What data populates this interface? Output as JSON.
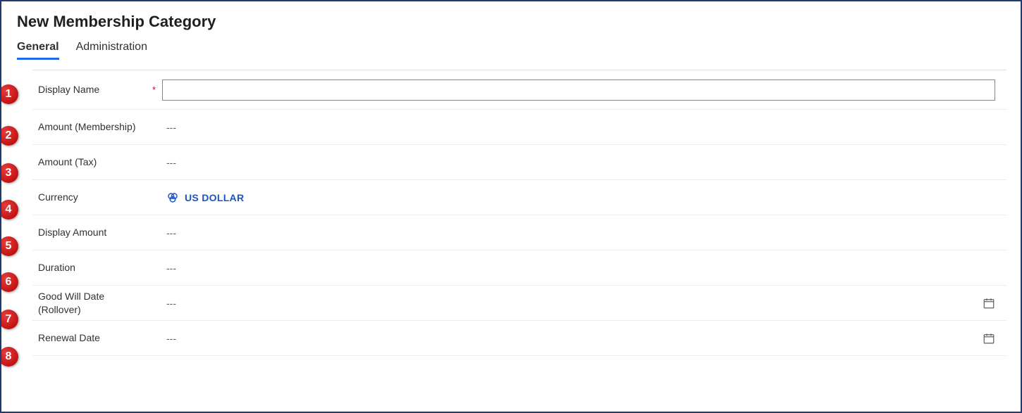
{
  "page_title": "New Membership Category",
  "tabs": [
    {
      "label": "General",
      "active": true
    },
    {
      "label": "Administration",
      "active": false
    }
  ],
  "rows": [
    {
      "num": "1",
      "label": "Display Name",
      "required": true,
      "kind": "input",
      "value": ""
    },
    {
      "num": "2",
      "label": "Amount (Membership)",
      "required": false,
      "kind": "text",
      "value": "---"
    },
    {
      "num": "3",
      "label": "Amount (Tax)",
      "required": false,
      "kind": "text",
      "value": "---"
    },
    {
      "num": "4",
      "label": "Currency",
      "required": false,
      "kind": "currency",
      "value": "US DOLLAR"
    },
    {
      "num": "5",
      "label": "Display Amount",
      "required": false,
      "kind": "text",
      "value": "---"
    },
    {
      "num": "6",
      "label": "Duration",
      "required": false,
      "kind": "text",
      "value": "---"
    },
    {
      "num": "7",
      "label": "Good Will Date (Rollover)",
      "required": false,
      "kind": "date",
      "value": "---"
    },
    {
      "num": "8",
      "label": "Renewal Date",
      "required": false,
      "kind": "date",
      "value": "---"
    }
  ],
  "required_mark": "*",
  "colors": {
    "accent": "#2169e6",
    "link": "#1b55c5",
    "badge": "#c31414",
    "border": "#1f3a73"
  }
}
